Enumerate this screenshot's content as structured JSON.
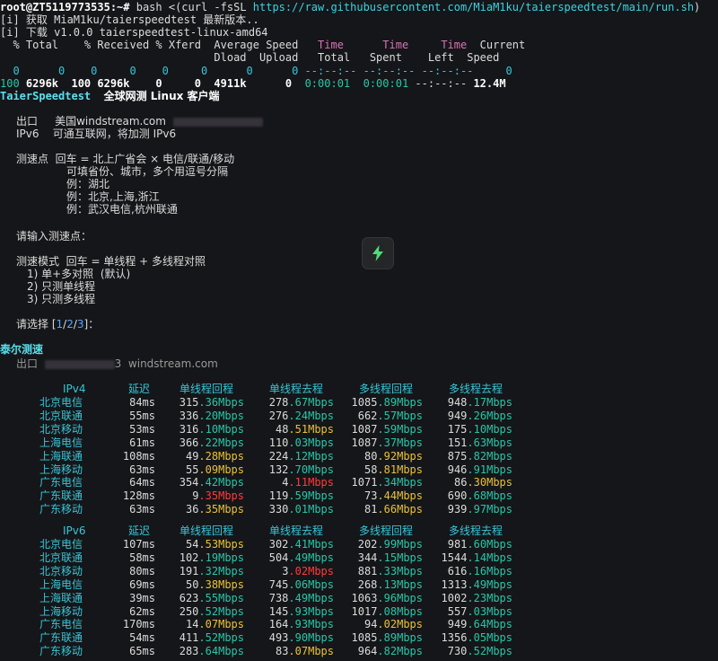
{
  "header": {
    "prompt": "root@ZT5119773535:~# ",
    "cmd_a": "bash <(curl -fsSL ",
    "cmd_url": "https://raw.githubusercontent.com/MiaM1ku/taierspeedtest/main/run.sh",
    "cmd_b": ")",
    "info1": "[i] 获取 MiaM1ku/taierspeedtest 最新版本..",
    "info2": "[i] 下载 v1.0.0 taierspeedtest-linux-amd64"
  },
  "curl": {
    "h1a": "  % Total    % Received % Xferd  Average Speed   ",
    "h1_time1": "Time",
    "h1_time2": "Time",
    "h1_time3": "Time",
    "h1_current": "Current",
    "h2a": "                                 Dload  Upload   ",
    "h2_total": "Total",
    "h2_spent": "Spent",
    "h2_left": "Left",
    "h2_speed": "Speed",
    "r1": "  0      0    0     0    0     0      0      0 --:--:-- --:--:-- --:--:--     0",
    "r2_a": "100",
    "r2_b": " 6296k  100 6296k    0     0  4911k      0 ",
    "r2_c": " 0:00:01  0:00:01 ",
    "r2_d": "--:--:-- ",
    "r2_e": "12.4M"
  },
  "app": {
    "name": "TaierSpeedtest",
    "subtitle": "全球网测 Linux 客户端",
    "exit_label": "出口",
    "exit_value": "美国windstream.com",
    "ipv6_label": "IPv6",
    "ipv6_value": "可通互联网，将加测 IPv6",
    "point_label": "测速点",
    "point_value": "回车 = 北上广省会 × 电信/联通/移动",
    "point_l2": "可填省份、城市，多个用逗号分隔",
    "point_l3": "例：湖北",
    "point_l4": "例：北京,上海,浙江",
    "point_l5": "例：武汉电信,杭州联通",
    "prompt_input": "请输入测速点：",
    "mode_label": "测速模式",
    "mode_value": "回车 = 单线程 + 多线程对照",
    "opt1": "1) 单+多对照  (默认)",
    "opt2": "2) 只测单线程",
    "opt3": "3) 只测多线程",
    "choose_a": "请选择 [",
    "choose_1": "1",
    "choose_s1": "/",
    "choose_2": "2",
    "choose_s2": "/",
    "choose_3": "3",
    "choose_b": "]：",
    "result_title": "泰尔测速",
    "exit2_label": "出口",
    "exit2_tail": "3  windstream.com"
  },
  "ipv4": {
    "headers": [
      "IPv4",
      "延迟",
      "单线程回程",
      "单线程去程",
      "多线程回程",
      "多线程去程"
    ],
    "rows": [
      [
        "北京电信",
        "84ms",
        "315.36Mbps",
        "278.67Mbps",
        "1085.89Mbps",
        "948.17Mbps"
      ],
      [
        "北京联通",
        "55ms",
        "336.20Mbps",
        "276.24Mbps",
        "662.57Mbps",
        "949.26Mbps"
      ],
      [
        "北京移动",
        "53ms",
        "316.10Mbps",
        "48.51Mbps",
        "1087.59Mbps",
        "175.10Mbps"
      ],
      [
        "上海电信",
        "61ms",
        "366.22Mbps",
        "110.03Mbps",
        "1087.37Mbps",
        "151.63Mbps"
      ],
      [
        "上海联通",
        "108ms",
        "49.28Mbps",
        "224.12Mbps",
        "80.92Mbps",
        "875.82Mbps"
      ],
      [
        "上海移动",
        "63ms",
        "55.09Mbps",
        "132.70Mbps",
        "58.81Mbps",
        "946.91Mbps"
      ],
      [
        "广东电信",
        "64ms",
        "354.42Mbps",
        "4.11Mbps",
        "1071.34Mbps",
        "86.30Mbps"
      ],
      [
        "广东联通",
        "128ms",
        "9.35Mbps",
        "119.59Mbps",
        "73.44Mbps",
        "690.68Mbps"
      ],
      [
        "广东移动",
        "63ms",
        "36.35Mbps",
        "330.01Mbps",
        "81.66Mbps",
        "939.97Mbps"
      ]
    ]
  },
  "ipv6": {
    "headers": [
      "IPv6",
      "延迟",
      "单线程回程",
      "单线程去程",
      "多线程回程",
      "多线程去程"
    ],
    "rows": [
      [
        "北京电信",
        "107ms",
        "54.53Mbps",
        "302.41Mbps",
        "202.99Mbps",
        "981.60Mbps"
      ],
      [
        "北京联通",
        "58ms",
        "102.19Mbps",
        "504.49Mbps",
        "344.15Mbps",
        "1544.14Mbps"
      ],
      [
        "北京移动",
        "80ms",
        "191.32Mbps",
        "3.02Mbps",
        "881.33Mbps",
        "616.16Mbps"
      ],
      [
        "上海电信",
        "69ms",
        "50.38Mbps",
        "745.06Mbps",
        "268.13Mbps",
        "1313.49Mbps"
      ],
      [
        "上海联通",
        "39ms",
        "623.55Mbps",
        "738.49Mbps",
        "1063.96Mbps",
        "1002.23Mbps"
      ],
      [
        "上海移动",
        "62ms",
        "250.52Mbps",
        "145.93Mbps",
        "1017.08Mbps",
        "557.03Mbps"
      ],
      [
        "广东电信",
        "170ms",
        "14.07Mbps",
        "164.93Mbps",
        "94.02Mbps",
        "949.64Mbps"
      ],
      [
        "广东联通",
        "54ms",
        "411.52Mbps",
        "493.90Mbps",
        "1085.89Mbps",
        "1356.05Mbps"
      ],
      [
        "广东移动",
        "65ms",
        "283.64Mbps",
        "83.07Mbps",
        "964.82Mbps",
        "730.52Mbps"
      ]
    ]
  },
  "colors": {
    "background": "#151619",
    "cyan": "#38c6d8",
    "magenta": "#d773b8",
    "yellow": "#e8c23a",
    "green": "#2ac6a8",
    "orange": "#e29a3a",
    "red": "#ff3b3b"
  },
  "icons": {
    "action_button": "lightning-icon"
  }
}
